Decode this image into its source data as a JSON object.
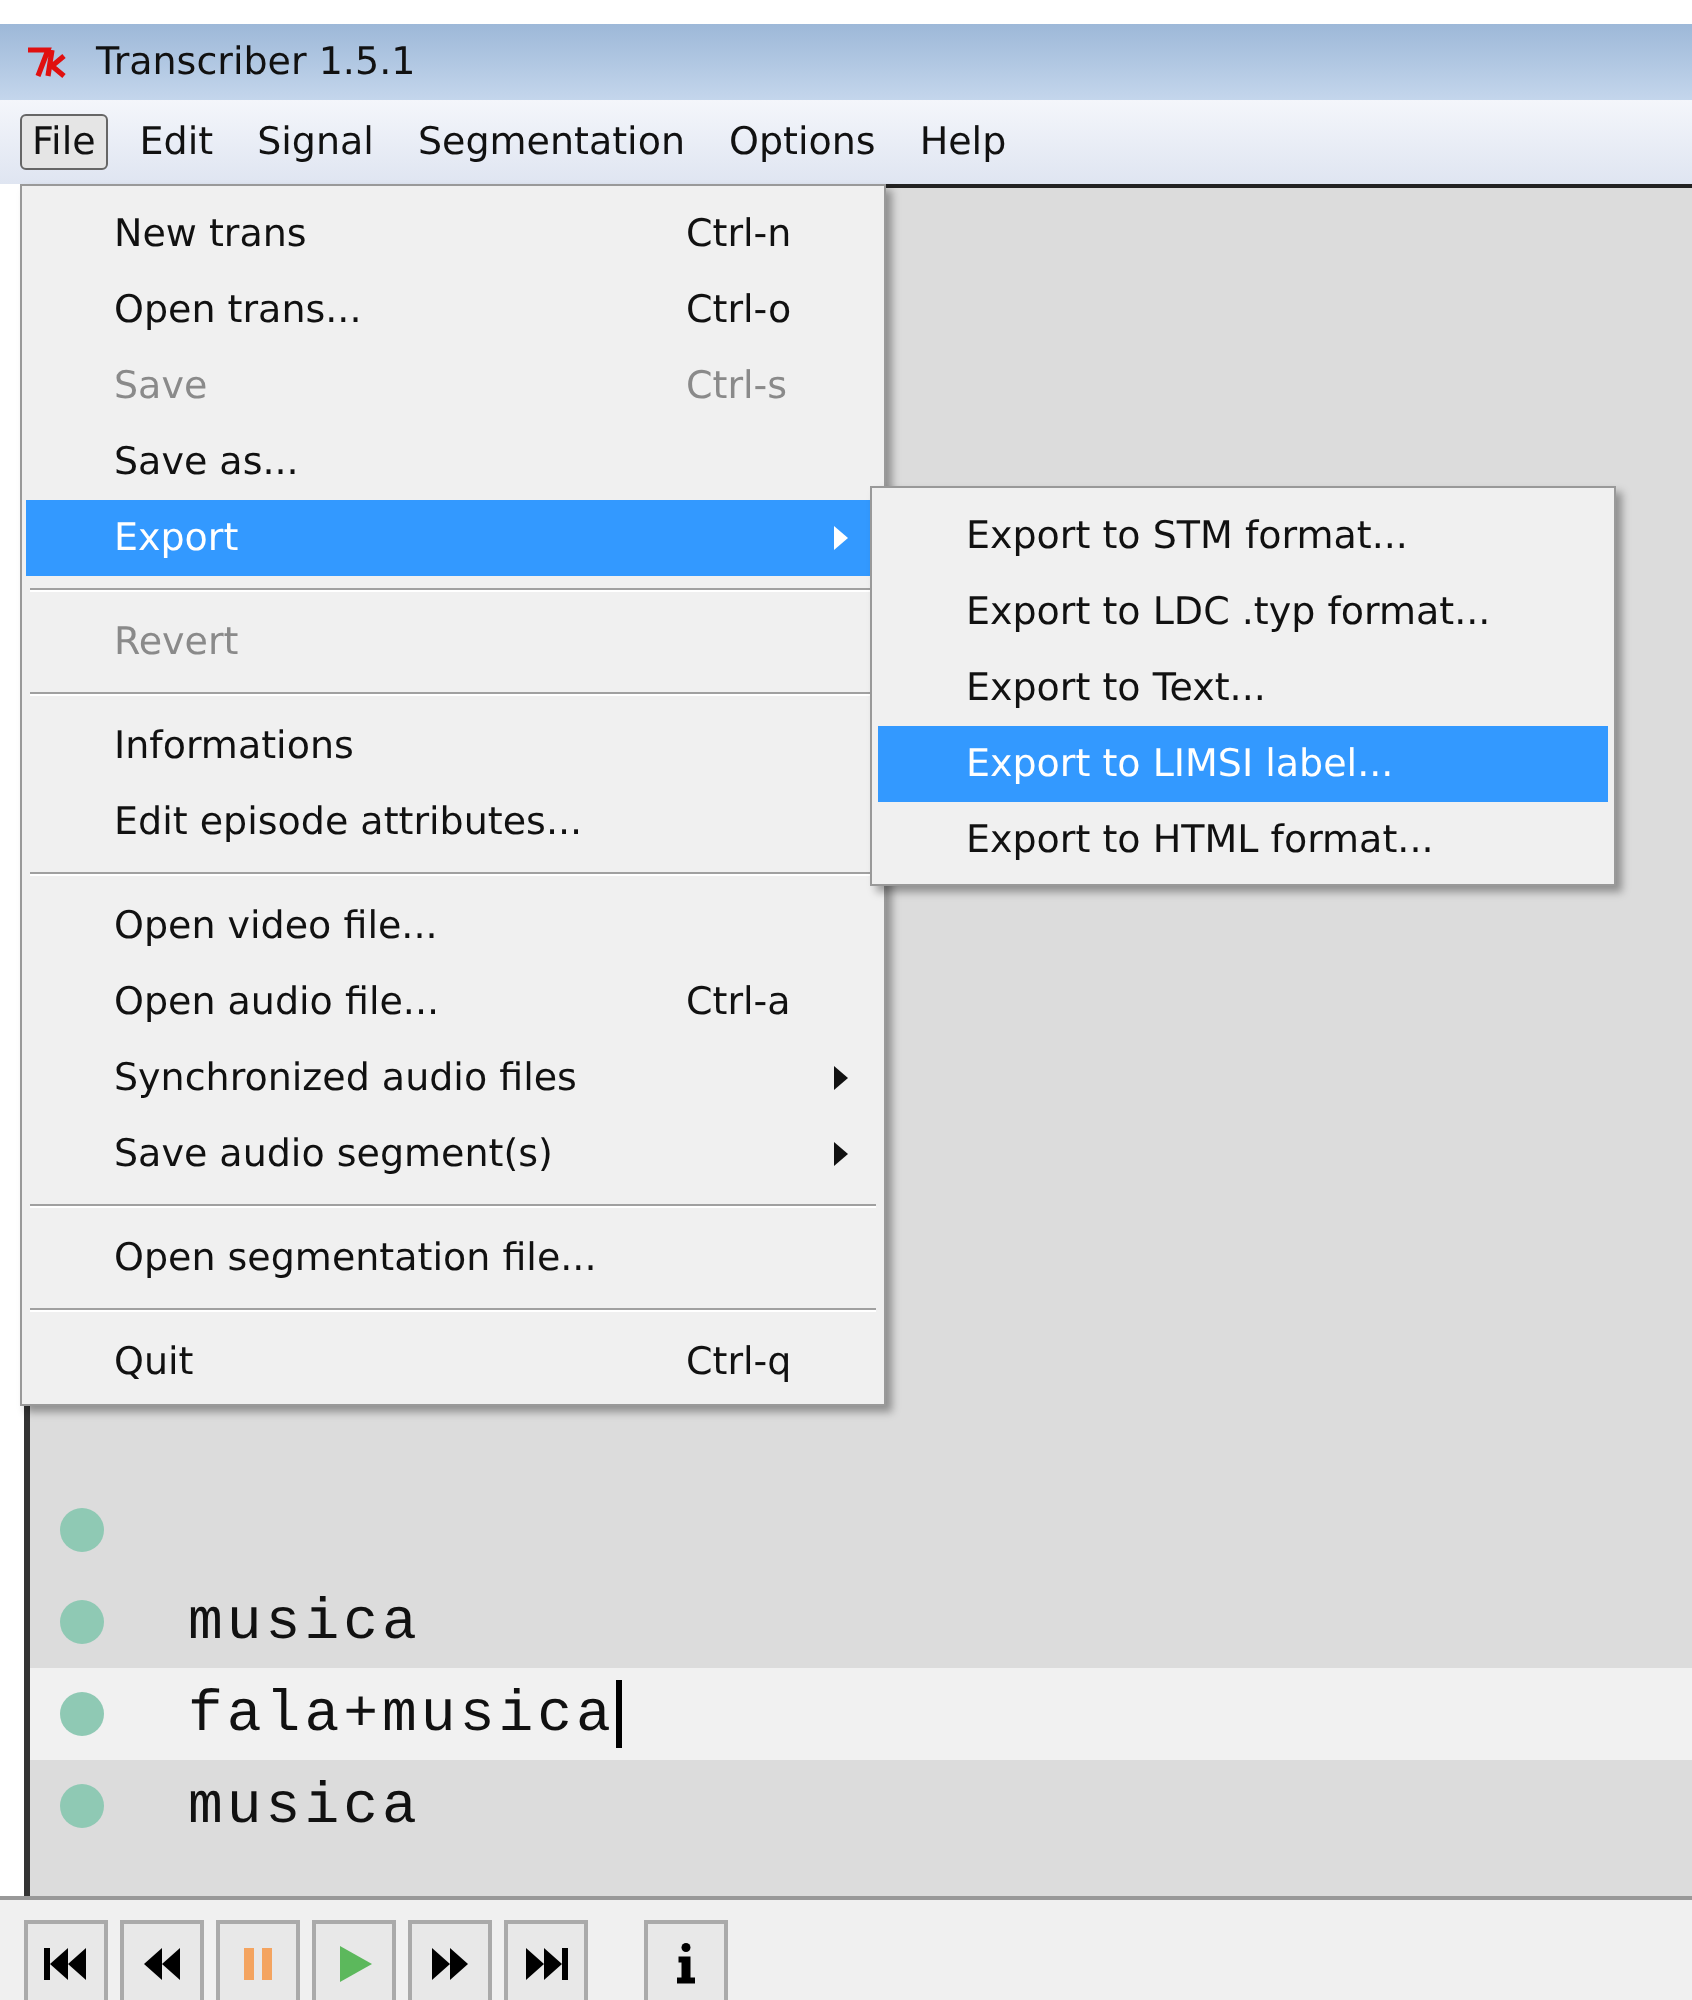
{
  "window": {
    "title": "Transcriber 1.5.1"
  },
  "menubar": [
    {
      "label": "File",
      "selected": true
    },
    {
      "label": "Edit",
      "selected": false
    },
    {
      "label": "Signal",
      "selected": false
    },
    {
      "label": "Segmentation",
      "selected": false
    },
    {
      "label": "Options",
      "selected": false
    },
    {
      "label": "Help",
      "selected": false
    }
  ],
  "file_menu": [
    {
      "kind": "item",
      "label": "New trans",
      "shortcut": "Ctrl-n",
      "disabled": false,
      "selected": false,
      "submenu": false
    },
    {
      "kind": "item",
      "label": "Open trans...",
      "shortcut": "Ctrl-o",
      "disabled": false,
      "selected": false,
      "submenu": false
    },
    {
      "kind": "item",
      "label": "Save",
      "shortcut": "Ctrl-s",
      "disabled": true,
      "selected": false,
      "submenu": false
    },
    {
      "kind": "item",
      "label": "Save as...",
      "disabled": false,
      "selected": false,
      "submenu": false
    },
    {
      "kind": "item",
      "label": "Export",
      "disabled": false,
      "selected": true,
      "submenu": true
    },
    {
      "kind": "separator"
    },
    {
      "kind": "item",
      "label": "Revert",
      "disabled": true,
      "selected": false,
      "submenu": false
    },
    {
      "kind": "separator"
    },
    {
      "kind": "item",
      "label": "Informations",
      "disabled": false,
      "selected": false,
      "submenu": false
    },
    {
      "kind": "item",
      "label": "Edit episode attributes...",
      "disabled": false,
      "selected": false,
      "submenu": false
    },
    {
      "kind": "separator"
    },
    {
      "kind": "item",
      "label": "Open video file...",
      "disabled": false,
      "selected": false,
      "submenu": false
    },
    {
      "kind": "item",
      "label": "Open audio file...",
      "shortcut": "Ctrl-a",
      "disabled": false,
      "selected": false,
      "submenu": false
    },
    {
      "kind": "item",
      "label": "Synchronized audio files",
      "disabled": false,
      "selected": false,
      "submenu": true
    },
    {
      "kind": "item",
      "label": "Save audio segment(s)",
      "disabled": false,
      "selected": false,
      "submenu": true
    },
    {
      "kind": "separator"
    },
    {
      "kind": "item",
      "label": "Open segmentation file...",
      "disabled": false,
      "selected": false,
      "submenu": false
    },
    {
      "kind": "separator"
    },
    {
      "kind": "item",
      "label": "Quit",
      "shortcut": "Ctrl-q",
      "disabled": false,
      "selected": false,
      "submenu": false
    }
  ],
  "export_submenu": [
    {
      "label": "Export to STM format...",
      "selected": false
    },
    {
      "label": "Export to LDC .typ format...",
      "selected": false
    },
    {
      "label": "Export to Text...",
      "selected": false
    },
    {
      "label": "Export to LIMSI label...",
      "selected": true
    },
    {
      "label": "Export to HTML format...",
      "selected": false
    }
  ],
  "segments": [
    {
      "selected": false
    },
    {
      "text": "musica",
      "selected": false
    },
    {
      "text": "fala+musica",
      "selected": true
    },
    {
      "text": "musica",
      "selected": false
    }
  ]
}
